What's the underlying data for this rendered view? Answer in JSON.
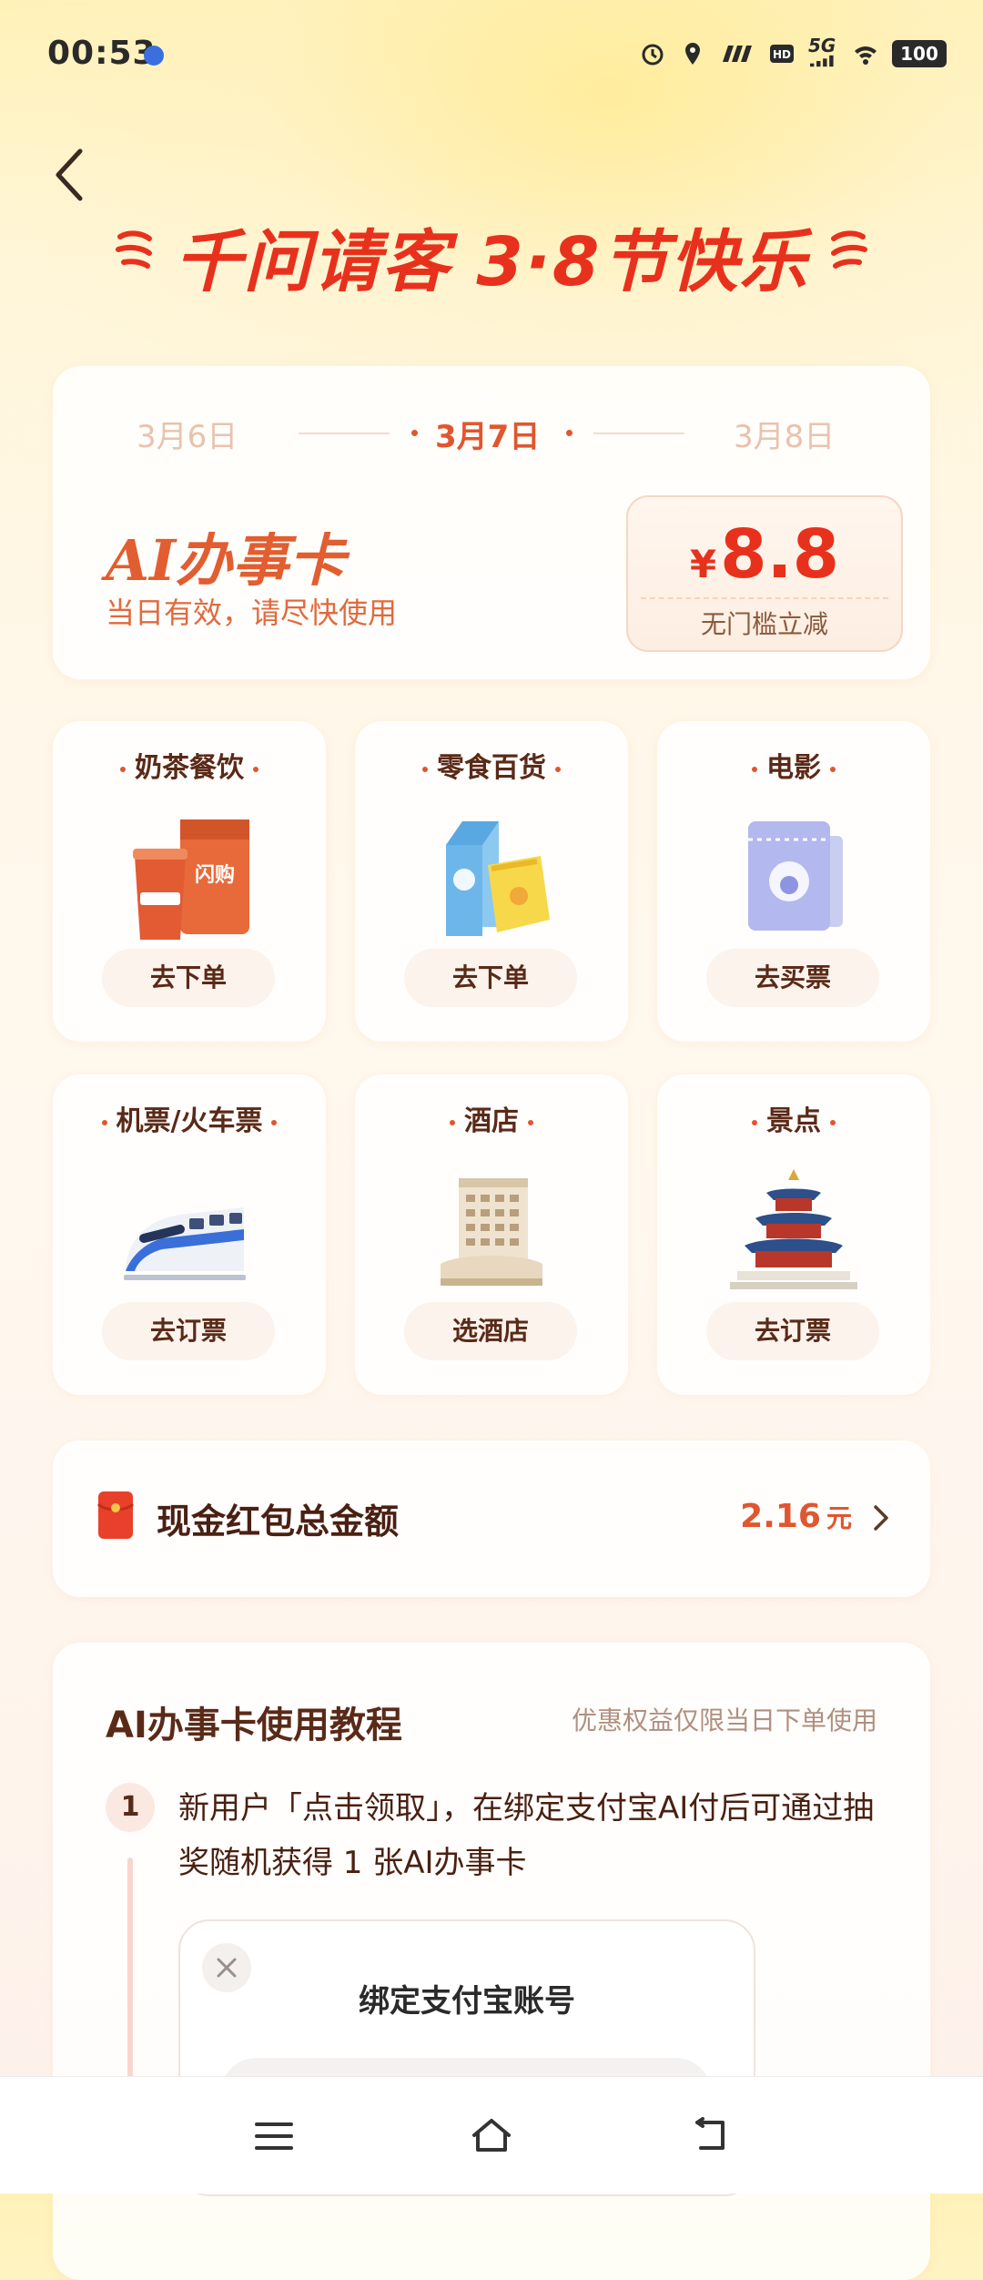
{
  "status_bar": {
    "time": "00:53",
    "network": "5G",
    "battery": "100",
    "icons": [
      "alarm-icon",
      "location-icon",
      "speed-icon",
      "hd-icon",
      "signal-icon",
      "wifi-icon",
      "battery-icon"
    ]
  },
  "header": {
    "banner": "千问请客 3·8节快乐"
  },
  "day_card": {
    "dates": [
      "3月6日",
      "3月7日",
      "3月8日"
    ],
    "selected_index": 1,
    "title": "AI办事卡",
    "subtitle": "当日有效，请尽快使用",
    "coupon": {
      "currency": "¥",
      "amount": "8.8",
      "label": "无门槛立减"
    }
  },
  "categories": [
    {
      "title": "奶茶餐饮",
      "button": "去下单",
      "icon": "milk-tea-bag-icon"
    },
    {
      "title": "零食百货",
      "button": "去下单",
      "icon": "snack-carton-icon"
    },
    {
      "title": "电影",
      "button": "去买票",
      "icon": "movie-ticket-icon"
    },
    {
      "title": "机票/火车票",
      "button": "去订票",
      "icon": "bullet-train-icon"
    },
    {
      "title": "酒店",
      "button": "选酒店",
      "icon": "hotel-building-icon"
    },
    {
      "title": "景点",
      "button": "去订票",
      "icon": "temple-icon"
    }
  ],
  "red_packet": {
    "label": "现金红包总金额",
    "amount": "2.16",
    "unit": "元"
  },
  "tutorial": {
    "title": "AI办事卡使用教程",
    "note": "优惠权益仅限当日下单使用",
    "step_number": "1",
    "step_text": "新用户「点击领取」，在绑定支付宝AI付后可通过抽奖随机获得 1 张AI办事卡",
    "preview_title": "绑定支付宝账号"
  },
  "colors": {
    "accent": "#e8311c",
    "accent_soft": "#e0562e",
    "text_dark": "#5a2a18"
  }
}
